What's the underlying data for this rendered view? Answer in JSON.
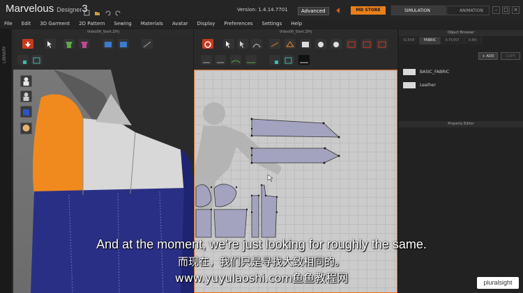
{
  "app": {
    "name": "Marvelous",
    "sub": "Designer",
    "num": "3",
    "version_label": "Version:",
    "version": "1.4.14.7701",
    "edition": "Advanced",
    "store": "MD STORE",
    "mode_simulation": "SIMULATION",
    "mode_animation": "ANIMATION"
  },
  "menu": [
    "File",
    "Edit",
    "3D Garment",
    "2D Pattern",
    "Sewing",
    "Materials",
    "Avatar",
    "Display",
    "Preferences",
    "Settings",
    "Help"
  ],
  "views": {
    "left_title": "Video06_Start.ZPrj",
    "right_title": "Video06_Start.ZPrj"
  },
  "sidebar": {
    "library_label": "LIBRARY"
  },
  "object_browser": {
    "title": "Object Browser",
    "tabs": [
      "SCENE",
      "FABRIC",
      "A-POINT",
      "A-BN"
    ],
    "active_tab": "FABRIC",
    "add_label": "ADD",
    "copy_label": "COPY",
    "fabrics": [
      "BASIC_FABRIC",
      "Leather"
    ]
  },
  "property_editor": {
    "title": "Property Editor"
  },
  "subtitles": {
    "en": "And at the moment, we're just looking for roughly the same.",
    "cn": "而现在，我们只是寻找大致相同的。",
    "url": "www.yuyulaoshi.com鱼鱼教程网"
  },
  "branding": "pluralsight",
  "colors": {
    "accent_orange": "#e8801a",
    "garment_blue": "#2a2f86",
    "garment_orange": "#f08a1f",
    "pattern_fill": "#a3a3bf"
  }
}
